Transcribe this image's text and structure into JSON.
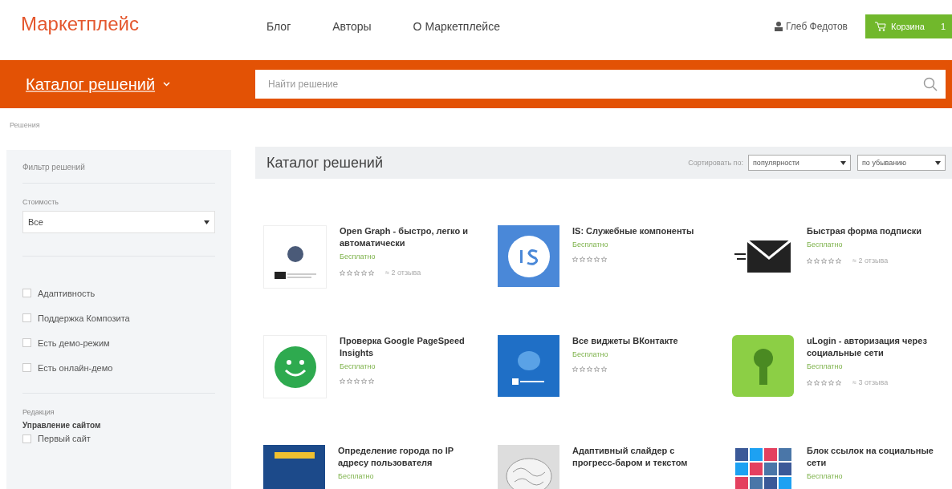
{
  "header": {
    "logo": "Маркетплейс",
    "nav": [
      "Блог",
      "Авторы",
      "О Маркетплейсе"
    ],
    "user": "Глеб Федотов",
    "cart": {
      "label": "Корзина",
      "count": "1"
    }
  },
  "catalog_bar": {
    "title": "Каталог решений",
    "search": {
      "placeholder": "Найти решение"
    }
  },
  "breadcrumb": "Решения",
  "sidebar": {
    "title": "Фильтр решений",
    "price": {
      "label": "Стоимость",
      "value": "Все"
    },
    "checks": [
      {
        "label": "Адаптивность",
        "checked": false
      },
      {
        "label": "Поддержка Композита",
        "checked": false
      },
      {
        "label": "Есть демо-режим",
        "checked": false
      },
      {
        "label": "Есть онлайн-демо",
        "checked": false
      }
    ],
    "edition": {
      "label": "Редакция",
      "group": "Управление сайтом",
      "checks": [
        {
          "label": "Первый сайт",
          "checked": false
        }
      ]
    }
  },
  "main": {
    "title": "Каталог решений",
    "sort_label": "Сортировать по:",
    "sort": "популярности",
    "order": "по убыванию",
    "apps": [
      {
        "kind": "opengraph",
        "title": "Open Graph - быстро, легко и автоматически",
        "price": "Бесплатно",
        "stars": 0,
        "reviews": "≈ 2 отзыва"
      },
      {
        "kind": "is",
        "title": "IS: Служебные компоненты",
        "price": "Бесплатно",
        "stars": 0
      },
      {
        "kind": "mail",
        "title": "Быстрая форма подписки",
        "price": "Бесплатно",
        "stars": 0,
        "reviews": "≈ 2 отзыва"
      },
      {
        "kind": "smile",
        "title": "Проверка Google PageSpeed Insights",
        "price": "Бесплатно",
        "stars": 0
      },
      {
        "kind": "vk",
        "title": "Все виджеты ВКонтакте",
        "price": "Бесплатно",
        "stars": 0
      },
      {
        "kind": "ulogin",
        "title": "uLogin - авторизация через социальные сети",
        "price": "Бесплатно",
        "stars": 0,
        "reviews": "≈ 3 отзыва"
      },
      {
        "kind": "geoip",
        "title": "Определение города по IP адресу пользователя",
        "price": "Бесплатно"
      },
      {
        "kind": "brain",
        "title": "Адаптивный слайдер с прогресс-баром и текстом"
      },
      {
        "kind": "social",
        "title": "Блок ссылок на социальные сети",
        "price": "Бесплатно"
      }
    ]
  }
}
